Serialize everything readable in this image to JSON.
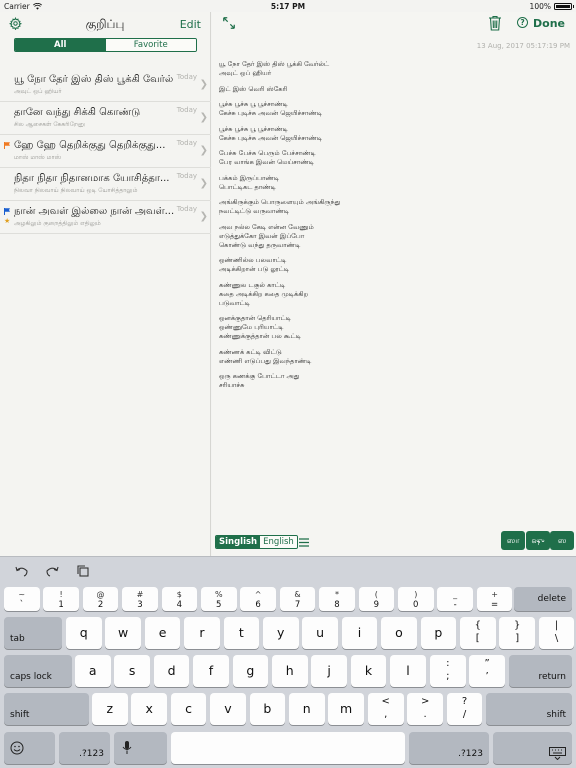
{
  "status": {
    "carrier": "Carrier",
    "time": "5:17 PM",
    "battery_text": "100%",
    "battery_level": 1.0
  },
  "left": {
    "title": "குறிப்பு",
    "edit_label": "Edit",
    "segments": {
      "all": "All",
      "favorite": "Favorite"
    },
    "notes": [
      {
        "title": "யூ நோ தேர் இஸ் திஸ் பூக்கி வேர்ல்ட்",
        "subtitle": "அவுட் ஒப் ஹியர்",
        "date": "Today",
        "flag": "",
        "star": false
      },
      {
        "title": "தானே வந்து சிக்கி கொண்டு",
        "subtitle": "சில ஆசைகள் கேகரிறேனு",
        "date": "Today",
        "flag": "",
        "star": false
      },
      {
        "title": "ஹே ஹே தெறிக்குது தெறிக்குது...",
        "subtitle": "மாஸ் மாஸ் மாஸ்",
        "date": "Today",
        "flag": "#f07a22",
        "star": false
      },
      {
        "title": "நிதா நிதா நிதானமாக யோசித்தா...",
        "subtitle": "நிலவா நிலவாய் நிலவாய் ஒடி யோசித்தாலும்",
        "date": "Today",
        "flag": "",
        "star": false
      },
      {
        "title": "நான் அவள் இல்லை நான் அவள்...",
        "subtitle": "அழகிலும் குறைத்திலும் எதிலும்",
        "date": "Today",
        "flag": "#1a5fd0",
        "star": true
      }
    ]
  },
  "right": {
    "timestamp": "13 Aug, 2017 05:17:19 PM",
    "done_label": "Done",
    "help_label": "?",
    "stanzas": [
      [
        "யூ நோ தேர் இஸ் திஸ் பூக்கி வேர்ல்ட்",
        "அவுட் ஒப் ஹியர்"
      ],
      [
        "இட் இஸ் வெரி ஸ்கேரி"
      ],
      [
        "பூச்சு பூச்சு பூ பூச்சாண்டி",
        "கேச்சு புடிச்சு அவன் ஜெயிச்சாண்டி"
      ],
      [
        "பூச்சு பூச்சு பூ பூச்சாண்டி",
        "கேச்சு புடிச்சு அவன் ஜெயிச்சாண்டி"
      ],
      [
        "பேச்சு பேச்சு பெரும் பேச்சாண்டி",
        "பேர வாங்க இவன் மெய்சாண்டி"
      ],
      [
        "பக்கம் இருப்பாண்டி",
        "பொட்டிகட தாண்டி"
      ],
      [
        "அங்கிருக்கும் பொருளையும் அங்கிருந்து",
        "நவட்டிட்டு வருவாண்டி"
      ],
      [
        "அவ நல்ல கேடி என்ன வேணும்",
        "எடுத்துக்கோ இவன் இப்போ",
        "கொண்டு வந்து தருவாண்டி"
      ],
      [
        "ஒண்ணில்ல பலவாட்டி",
        "அடிக்கிறான் படு லூட்டி"
      ],
      [
        "கண்ணுல டகுல் காட்டி",
        "கதை அடிக்கிற கதை முடிக்கிற",
        "படுவாட்டி"
      ],
      [
        "ஒனக்குதான் தெரியாட்டி",
        "ஒண்ணுமே புரியாட்டி",
        "கண்ணுக்குத்தான் பல கூட்டி"
      ],
      [
        "கண்ணக் கட்டி விட்டு",
        "எண்ணி எடுப்பது இவந்தாண்டி"
      ],
      [
        "ஒரு கணக்கு போட்டா அது",
        "சரியாச்சு"
      ]
    ],
    "lang": {
      "singlish": "Singlish",
      "english": "English"
    },
    "char_keys": [
      "ஸா",
      "ஷு",
      "ஸ"
    ]
  },
  "keyboard": {
    "num_row": [
      {
        "top": "~",
        "bottom": "`"
      },
      {
        "top": "!",
        "bottom": "1"
      },
      {
        "top": "@",
        "bottom": "2"
      },
      {
        "top": "#",
        "bottom": "3"
      },
      {
        "top": "$",
        "bottom": "4"
      },
      {
        "top": "%",
        "bottom": "5"
      },
      {
        "top": "^",
        "bottom": "6"
      },
      {
        "top": "&",
        "bottom": "7"
      },
      {
        "top": "*",
        "bottom": "8"
      },
      {
        "top": "(",
        "bottom": "9"
      },
      {
        "top": ")",
        "bottom": "0"
      },
      {
        "top": "_",
        "bottom": "-"
      },
      {
        "top": "+",
        "bottom": "="
      }
    ],
    "delete": "delete",
    "tab": "tab",
    "row1": [
      "q",
      "w",
      "e",
      "r",
      "t",
      "y",
      "u",
      "i",
      "o",
      "p"
    ],
    "row1_extra": [
      {
        "top": "{",
        "bottom": "["
      },
      {
        "top": "}",
        "bottom": "]"
      },
      {
        "top": "|",
        "bottom": "\\"
      }
    ],
    "caps": "caps lock",
    "row2": [
      "a",
      "s",
      "d",
      "f",
      "g",
      "h",
      "j",
      "k",
      "l"
    ],
    "row2_extra": [
      {
        "top": ":",
        "bottom": ";"
      },
      {
        "top": "”",
        "bottom": "’"
      }
    ],
    "return": "return",
    "shift": "shift",
    "row3": [
      "z",
      "x",
      "c",
      "v",
      "b",
      "n",
      "m"
    ],
    "row3_extra": [
      {
        "top": "<",
        "bottom": ","
      },
      {
        "top": ">",
        "bottom": "."
      },
      {
        "top": "?",
        "bottom": "/"
      }
    ],
    "numbers": ".?123"
  }
}
